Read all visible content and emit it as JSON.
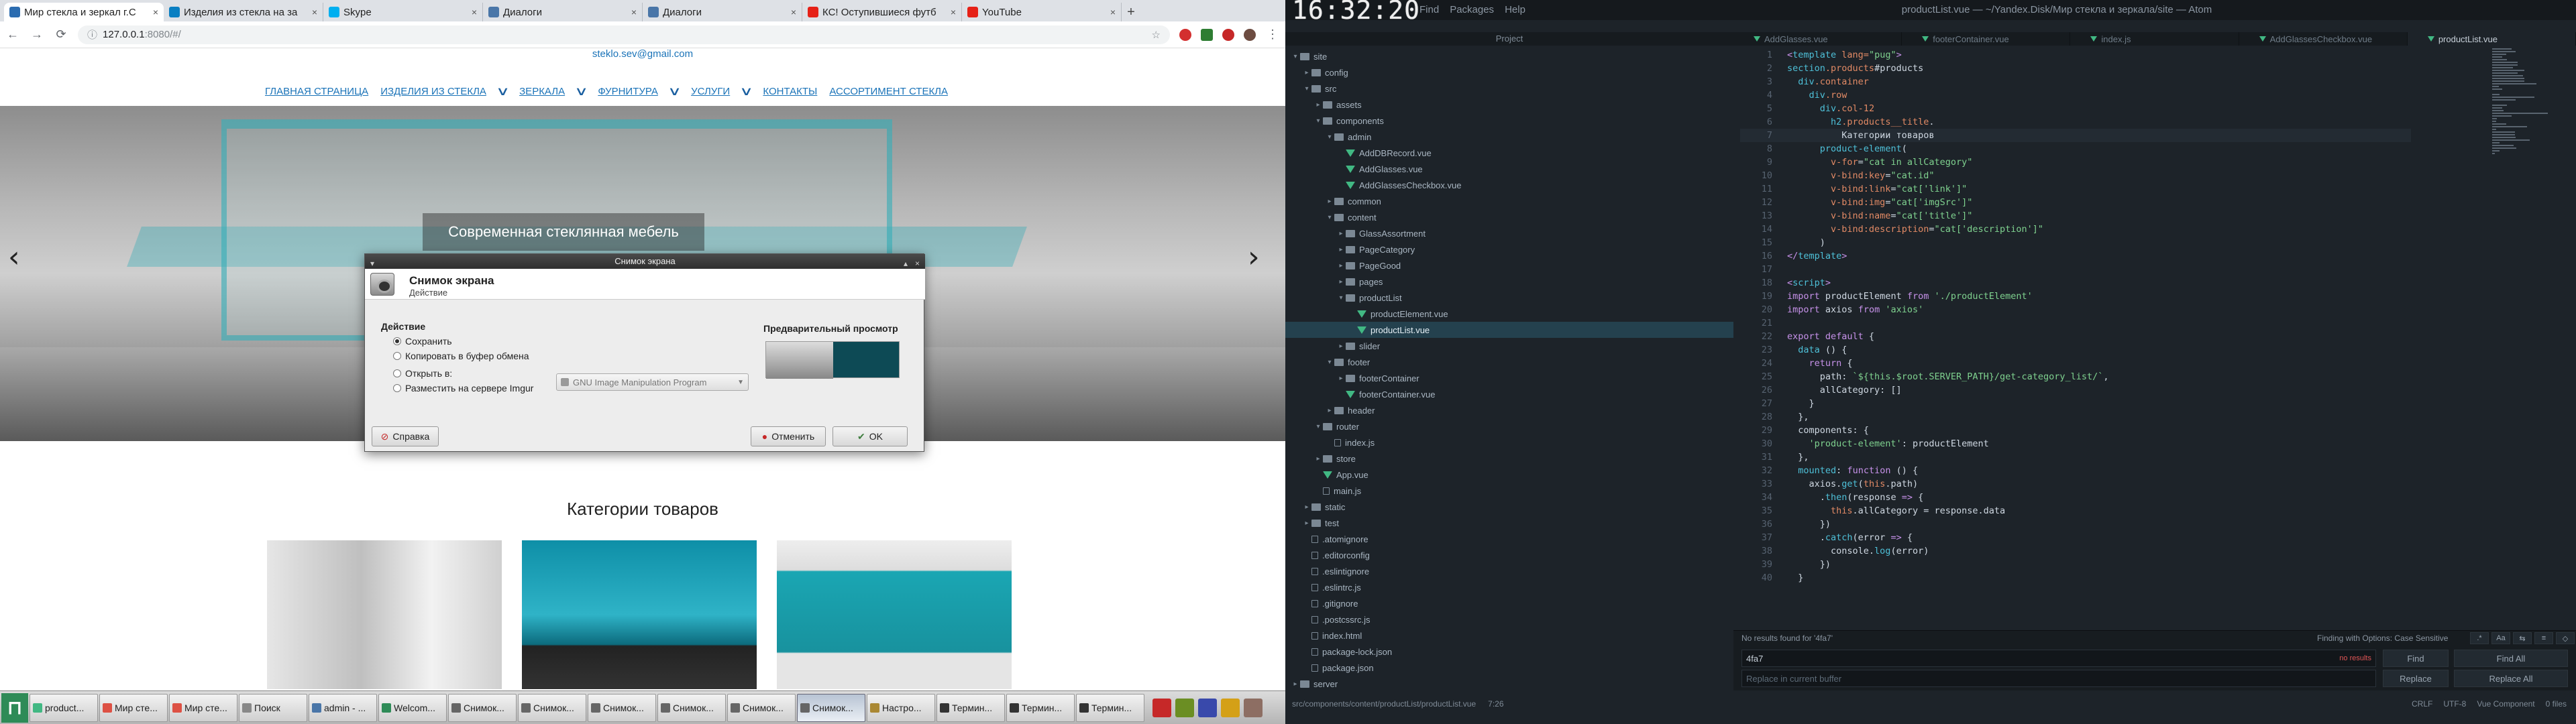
{
  "browser": {
    "tabs": [
      {
        "label": "Мир стекла и зеркал г.С",
        "fav": "#2b6cb0",
        "active": true
      },
      {
        "label": "Изделия из стекла на за",
        "fav": "#0a7fc2"
      },
      {
        "label": "Skype",
        "fav": "#00aff0"
      },
      {
        "label": "Диалоги",
        "fav": "#4a76a8"
      },
      {
        "label": "Диалоги",
        "fav": "#4a76a8"
      },
      {
        "label": "КС! Оступившиеся футб",
        "fav": "#e62117"
      },
      {
        "label": "YouTube",
        "fav": "#e62117"
      }
    ],
    "close_glyph": "×",
    "new_tab": "+",
    "address": {
      "host": "127.0.0.1",
      "rest": ":8080/#/"
    },
    "nav_icons": {
      "back": "←",
      "forward": "→",
      "reload": "⟳",
      "info": "ⓘ",
      "star": "☆",
      "menu": "⋮"
    }
  },
  "site": {
    "email": "steklo.sev@gmail.com",
    "nav": [
      "Главная страница",
      "Изделия из стекла",
      "Зеркала",
      "Фурнитура",
      "Услуги",
      "Контакты",
      "Ассортимент стекла"
    ],
    "chev": "∨",
    "hero_caption": "Современная стеклянная мебель",
    "arrow_left": "‹",
    "arrow_right": "›",
    "categories_title": "Категории товаров"
  },
  "dialog": {
    "window_title": "Снимок экрана",
    "heading": "Снимок экрана",
    "subheading": "Действие",
    "section": "Действие",
    "options": [
      "Сохранить",
      "Копировать в буфер обмена",
      "Открыть в:",
      "Разместить на сервере Imgur"
    ],
    "selected_index": 0,
    "app_select": "GNU Image Manipulation Program",
    "preview_label": "Предварительный просмотр",
    "help": "Справка",
    "cancel": "Отменить",
    "ok": "OK"
  },
  "atom": {
    "clock": "16:32:20",
    "menu": [
      "Find",
      "Packages",
      "Help"
    ],
    "window_title": "productList.vue — ~/Yandex.Disk/Мир стекла и зеркала/site — Atom",
    "tree_header": "Project",
    "tabs": [
      "AddGlasses.vue",
      "footerContainer.vue",
      "index.js",
      "AddGlassesCheckbox.vue",
      "productList.vue"
    ],
    "active_tab": 4,
    "tree": [
      {
        "d": 0,
        "t": "folder",
        "open": true,
        "n": "site"
      },
      {
        "d": 1,
        "t": "folder",
        "open": false,
        "n": "config"
      },
      {
        "d": 1,
        "t": "folder",
        "open": true,
        "n": "src"
      },
      {
        "d": 2,
        "t": "folder",
        "open": false,
        "n": "assets"
      },
      {
        "d": 2,
        "t": "folder",
        "open": true,
        "n": "components"
      },
      {
        "d": 3,
        "t": "folder",
        "open": true,
        "n": "admin"
      },
      {
        "d": 4,
        "t": "vue",
        "n": "AddDBRecord.vue"
      },
      {
        "d": 4,
        "t": "vue",
        "n": "AddGlasses.vue"
      },
      {
        "d": 4,
        "t": "vue",
        "n": "AddGlassesCheckbox.vue"
      },
      {
        "d": 3,
        "t": "folder",
        "open": false,
        "n": "common"
      },
      {
        "d": 3,
        "t": "folder",
        "open": true,
        "n": "content"
      },
      {
        "d": 4,
        "t": "folder",
        "open": false,
        "n": "GlassAssortment"
      },
      {
        "d": 4,
        "t": "folder",
        "open": false,
        "n": "PageCategory"
      },
      {
        "d": 4,
        "t": "folder",
        "open": false,
        "n": "PageGood"
      },
      {
        "d": 4,
        "t": "folder",
        "open": false,
        "n": "pages"
      },
      {
        "d": 4,
        "t": "folder",
        "open": true,
        "n": "productList"
      },
      {
        "d": 5,
        "t": "vue",
        "n": "productElement.vue"
      },
      {
        "d": 5,
        "t": "vue",
        "n": "productList.vue",
        "sel": true
      },
      {
        "d": 4,
        "t": "folder",
        "open": false,
        "n": "slider"
      },
      {
        "d": 3,
        "t": "folder",
        "open": true,
        "n": "footer"
      },
      {
        "d": 4,
        "t": "folder",
        "open": false,
        "n": "footerContainer"
      },
      {
        "d": 4,
        "t": "vue",
        "n": "footerContainer.vue"
      },
      {
        "d": 3,
        "t": "folder",
        "open": false,
        "n": "header"
      },
      {
        "d": 2,
        "t": "folder",
        "open": true,
        "n": "router"
      },
      {
        "d": 3,
        "t": "file",
        "n": "index.js"
      },
      {
        "d": 2,
        "t": "folder",
        "open": false,
        "n": "store"
      },
      {
        "d": 2,
        "t": "vue",
        "n": "App.vue"
      },
      {
        "d": 2,
        "t": "file",
        "n": "main.js"
      },
      {
        "d": 1,
        "t": "folder",
        "open": false,
        "n": "static"
      },
      {
        "d": 1,
        "t": "folder",
        "open": false,
        "n": "test"
      },
      {
        "d": 1,
        "t": "file",
        "n": ".atomignore"
      },
      {
        "d": 1,
        "t": "file",
        "n": ".editorconfig"
      },
      {
        "d": 1,
        "t": "file",
        "n": ".eslintignore"
      },
      {
        "d": 1,
        "t": "file",
        "n": ".eslintrc.js"
      },
      {
        "d": 1,
        "t": "file",
        "n": ".gitignore"
      },
      {
        "d": 1,
        "t": "file",
        "n": ".postcssrc.js"
      },
      {
        "d": 1,
        "t": "file",
        "n": "index.html"
      },
      {
        "d": 1,
        "t": "file",
        "n": "package-lock.json"
      },
      {
        "d": 1,
        "t": "file",
        "n": "package.json"
      },
      {
        "d": 0,
        "t": "folder",
        "open": false,
        "n": "server"
      }
    ],
    "code": [
      [
        [
          "p",
          "<"
        ],
        [
          "t",
          "template"
        ],
        [
          "a",
          " lang="
        ],
        [
          "s",
          "\"pug\""
        ],
        [
          "p",
          ">"
        ]
      ],
      [
        [
          "t",
          "section"
        ],
        [
          "a",
          ".products"
        ],
        [
          "n",
          "#products"
        ]
      ],
      [
        [
          "n",
          "  "
        ],
        [
          "t",
          "div"
        ],
        [
          "a",
          ".container"
        ]
      ],
      [
        [
          "n",
          "    "
        ],
        [
          "t",
          "div"
        ],
        [
          "a",
          ".row"
        ]
      ],
      [
        [
          "n",
          "      "
        ],
        [
          "t",
          "div"
        ],
        [
          "a",
          ".col-12"
        ]
      ],
      [
        [
          "n",
          "        "
        ],
        [
          "t",
          "h2"
        ],
        [
          "a",
          ".products__title"
        ],
        [
          "n",
          "."
        ]
      ],
      [
        [
          "n",
          "          Категории товаров"
        ]
      ],
      [
        [
          "n",
          "      "
        ],
        [
          "t",
          "product-element"
        ],
        [
          "n",
          "("
        ]
      ],
      [
        [
          "n",
          "        "
        ],
        [
          "a",
          "v-for"
        ],
        [
          "n",
          "="
        ],
        [
          "s",
          "\"cat in allCategory\""
        ]
      ],
      [
        [
          "n",
          "        "
        ],
        [
          "a",
          "v-bind:key"
        ],
        [
          "n",
          "="
        ],
        [
          "s",
          "\"cat.id\""
        ]
      ],
      [
        [
          "n",
          "        "
        ],
        [
          "a",
          "v-bind:link"
        ],
        [
          "n",
          "="
        ],
        [
          "s",
          "\"cat['link']\""
        ]
      ],
      [
        [
          "n",
          "        "
        ],
        [
          "a",
          "v-bind:img"
        ],
        [
          "n",
          "="
        ],
        [
          "s",
          "\"cat['imgSrc']\""
        ]
      ],
      [
        [
          "n",
          "        "
        ],
        [
          "a",
          "v-bind:name"
        ],
        [
          "n",
          "="
        ],
        [
          "s",
          "\"cat['title']\""
        ]
      ],
      [
        [
          "n",
          "        "
        ],
        [
          "a",
          "v-bind:description"
        ],
        [
          "n",
          "="
        ],
        [
          "s",
          "\"cat['description']\""
        ]
      ],
      [
        [
          "n",
          "      )"
        ]
      ],
      [
        [
          "p",
          "</"
        ],
        [
          "t",
          "template"
        ],
        [
          "p",
          ">"
        ]
      ],
      [],
      [
        [
          "p",
          "<"
        ],
        [
          "t",
          "script"
        ],
        [
          "p",
          ">"
        ]
      ],
      [
        [
          "p",
          "import"
        ],
        [
          "n",
          " productElement "
        ],
        [
          "p",
          "from"
        ],
        [
          "s",
          " './productElement'"
        ]
      ],
      [
        [
          "p",
          "import"
        ],
        [
          "n",
          " axios "
        ],
        [
          "p",
          "from"
        ],
        [
          "s",
          " 'axios'"
        ]
      ],
      [],
      [
        [
          "p",
          "export default"
        ],
        [
          "n",
          " {"
        ]
      ],
      [
        [
          "n",
          "  "
        ],
        [
          "t",
          "data"
        ],
        [
          "n",
          " () {"
        ]
      ],
      [
        [
          "n",
          "    "
        ],
        [
          "p",
          "return"
        ],
        [
          "n",
          " {"
        ]
      ],
      [
        [
          "n",
          "      path: "
        ],
        [
          "s",
          "`${this.$root.SERVER_PATH}/get-category_list/`"
        ],
        [
          "n",
          ","
        ]
      ],
      [
        [
          "n",
          "      allCategory: []"
        ]
      ],
      [
        [
          "n",
          "    }"
        ]
      ],
      [
        [
          "n",
          "  },"
        ]
      ],
      [
        [
          "n",
          "  components: {"
        ]
      ],
      [
        [
          "s",
          "    'product-element'"
        ],
        [
          "n",
          ": productElement"
        ]
      ],
      [
        [
          "n",
          "  },"
        ]
      ],
      [
        [
          "n",
          "  "
        ],
        [
          "t",
          "mounted"
        ],
        [
          "n",
          ": "
        ],
        [
          "p",
          "function"
        ],
        [
          "n",
          " () {"
        ]
      ],
      [
        [
          "n",
          "    axios."
        ],
        [
          "t",
          "get"
        ],
        [
          "n",
          "("
        ],
        [
          "a",
          "this"
        ],
        [
          "n",
          ".path)"
        ]
      ],
      [
        [
          "n",
          "      ."
        ],
        [
          "t",
          "then"
        ],
        [
          "n",
          "(response "
        ],
        [
          "p",
          "=>"
        ],
        [
          "n",
          " {"
        ]
      ],
      [
        [
          "n",
          "        "
        ],
        [
          "a",
          "this"
        ],
        [
          "n",
          ".allCategory = response.data"
        ]
      ],
      [
        [
          "n",
          "      })"
        ]
      ],
      [
        [
          "n",
          "      ."
        ],
        [
          "t",
          "catch"
        ],
        [
          "n",
          "(error "
        ],
        [
          "p",
          "=>"
        ],
        [
          "n",
          " {"
        ]
      ],
      [
        [
          "n",
          "        console."
        ],
        [
          "t",
          "log"
        ],
        [
          "n",
          "(error)"
        ]
      ],
      [
        [
          "n",
          "      })"
        ]
      ],
      [
        [
          "n",
          "  }"
        ]
      ]
    ],
    "cursor_line": 7,
    "find": {
      "status": "No results found for '4fa7'",
      "options_label": "Finding with Options:",
      "case_label": "Case Sensitive",
      "query": "4fa7",
      "no_results": "no results",
      "replace_placeholder": "Replace in current buffer",
      "find": "Find",
      "find_all": "Find All",
      "replace": "Replace",
      "replace_all": "Replace All",
      "opts": [
        ".*",
        "Aa",
        "⇆",
        "≡",
        "◇"
      ]
    },
    "status": {
      "path": "src/components/content/productList/productList.vue",
      "pos": "7:26",
      "crlf": "CRLF",
      "enc": "UTF-8",
      "grammar": "Vue Component",
      "files": "0 files"
    }
  },
  "taskbar": {
    "start": "⊓",
    "items": [
      {
        "label": "product...",
        "c": "#41b883"
      },
      {
        "label": "Мир сте...",
        "c": "#dd5144"
      },
      {
        "label": "Мир сте...",
        "c": "#dd5144"
      },
      {
        "label": "Поиск",
        "c": "#888"
      },
      {
        "label": "admin - ...",
        "c": "#4a76a8"
      },
      {
        "label": "Welcom...",
        "c": "#2e8b57"
      },
      {
        "label": "Снимок...",
        "c": "#666"
      },
      {
        "label": "Снимок...",
        "c": "#666"
      },
      {
        "label": "Снимок...",
        "c": "#666"
      },
      {
        "label": "Снимок...",
        "c": "#666"
      },
      {
        "label": "Снимок...",
        "c": "#666"
      },
      {
        "label": "Снимок...",
        "c": "#666",
        "active": true
      },
      {
        "label": "Настро...",
        "c": "#aa8833"
      },
      {
        "label": "Термин...",
        "c": "#333"
      },
      {
        "label": "Термин...",
        "c": "#333"
      },
      {
        "label": "Термин...",
        "c": "#333"
      }
    ],
    "tray": [
      "#c62828",
      "#6b8e23",
      "#3949ab",
      "#d4a017",
      "#8d6e63"
    ]
  }
}
